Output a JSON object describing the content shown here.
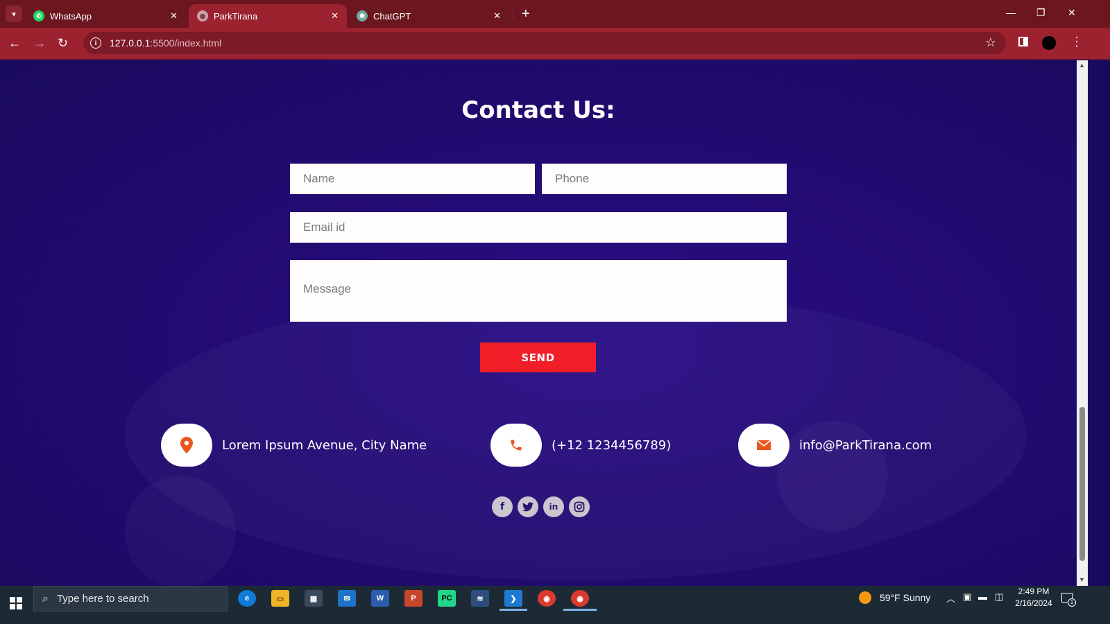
{
  "browser": {
    "tabs": [
      {
        "label": "WhatsApp",
        "active": false
      },
      {
        "label": "ParkTirana",
        "active": true
      },
      {
        "label": "ChatGPT",
        "active": false
      }
    ],
    "url_host": "127.0.0.1",
    "url_path": ":5500/index.html"
  },
  "contact": {
    "title": "Contact Us:",
    "name_placeholder": "Name",
    "phone_placeholder": "Phone",
    "email_placeholder": "Email id",
    "message_placeholder": "Message",
    "send_label": "SEND",
    "address": "Lorem Ipsum Avenue, City Name",
    "phone": "(+12 1234456789)",
    "email": "info@ParkTirana.com",
    "accent_color": "#f11d27",
    "icon_color": "#e8561c",
    "socials": [
      "facebook-icon",
      "twitter-icon",
      "linkedin-icon",
      "instagram-icon"
    ]
  },
  "taskbar": {
    "search_placeholder": "Type here to search",
    "weather": "59°F  Sunny",
    "time": "2:49 PM",
    "date": "2/16/2024",
    "notifications": "1"
  }
}
